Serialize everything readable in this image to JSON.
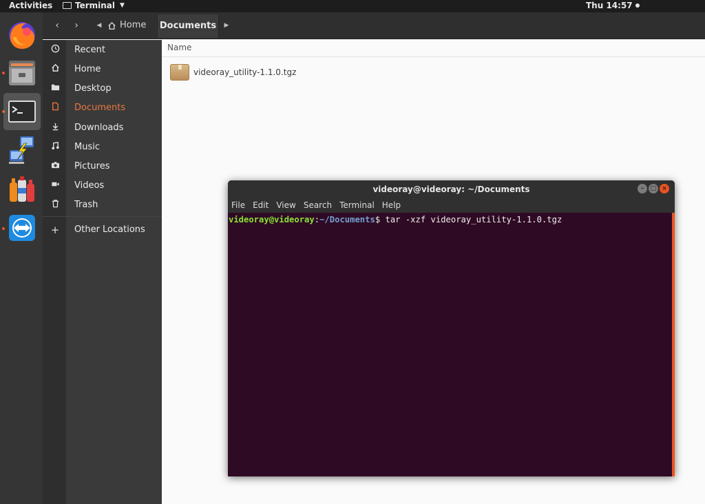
{
  "topbar": {
    "activities": "Activities",
    "app_menu": "Terminal",
    "clock": "Thu 14:57"
  },
  "dock": {
    "items": [
      {
        "name": "Firefox",
        "icon": "firefox-icon"
      },
      {
        "name": "Files",
        "icon": "files-icon"
      },
      {
        "name": "Terminal",
        "icon": "terminal-icon"
      },
      {
        "name": "Network",
        "icon": "network-icon"
      },
      {
        "name": "Bottles",
        "icon": "bottles-icon"
      },
      {
        "name": "TeamViewer",
        "icon": "teamviewer-icon"
      }
    ]
  },
  "files": {
    "breadcrumb": {
      "home": "Home",
      "current": "Documents"
    },
    "sidebar": [
      {
        "label": "Recent",
        "icon": "clock-icon"
      },
      {
        "label": "Home",
        "icon": "home-icon"
      },
      {
        "label": "Desktop",
        "icon": "folder-icon"
      },
      {
        "label": "Documents",
        "icon": "document-icon"
      },
      {
        "label": "Downloads",
        "icon": "download-icon"
      },
      {
        "label": "Music",
        "icon": "music-icon"
      },
      {
        "label": "Pictures",
        "icon": "camera-icon"
      },
      {
        "label": "Videos",
        "icon": "video-icon"
      },
      {
        "label": "Trash",
        "icon": "trash-icon"
      },
      {
        "label": "Other Locations",
        "icon": "plus-icon"
      }
    ],
    "column_header": "Name",
    "files": [
      {
        "name": "videoray_utility-1.1.0.tgz",
        "icon": "package-icon"
      }
    ]
  },
  "terminal": {
    "title": "videoray@videoray: ~/Documents",
    "menu": [
      "File",
      "Edit",
      "View",
      "Search",
      "Terminal",
      "Help"
    ],
    "prompt_user": "videoray@videoray",
    "prompt_sep": ":",
    "prompt_path": "~/Documents",
    "prompt_symbol": "$",
    "command": " tar -xzf videoray_utility-1.1.0.tgz"
  },
  "colors": {
    "accent": "#e95420",
    "terminal_bg": "#2f0a24",
    "prompt_user": "#8ae234",
    "prompt_path": "#729fcf"
  }
}
